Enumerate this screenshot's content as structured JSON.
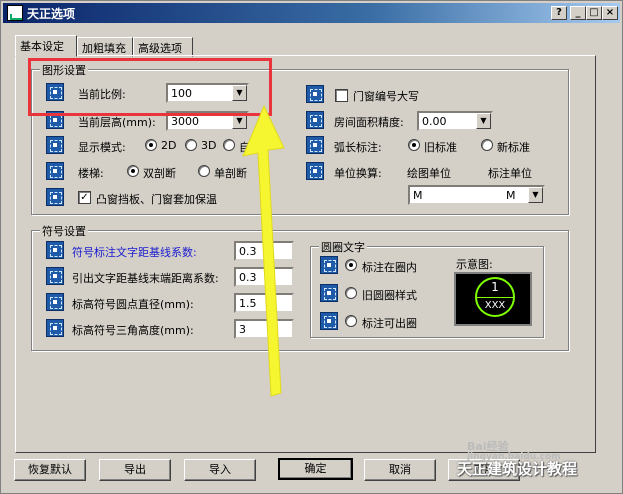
{
  "window": {
    "title": "天正选项",
    "controls": {
      "help": "?",
      "minimize": "_",
      "maximize": "□",
      "close": "×"
    }
  },
  "tabs": [
    {
      "label": "基本设定",
      "active": true
    },
    {
      "label": "加粗填充",
      "active": false
    },
    {
      "label": "高级选项",
      "active": false
    }
  ],
  "graphics": {
    "title": "图形设置",
    "scale_label": "当前比例:",
    "scale_value": "100",
    "floor_height_label": "当前层高(mm):",
    "floor_height_value": "3000",
    "display_mode_label": "显示模式:",
    "display_options": [
      "2D",
      "3D",
      "自动"
    ],
    "display_selected": "2D",
    "stairs_label": "楼梯:",
    "stairs_options": [
      "双剖断",
      "单剖断"
    ],
    "stairs_selected": "双剖断",
    "bay_window_label": "凸窗挡板、门窗套加保温",
    "bay_window_checked": true,
    "door_caps_label": "门窗编号大写",
    "door_caps_checked": false,
    "room_precision_label": "房间面积精度:",
    "room_precision_value": "0.00",
    "arc_label": "弧长标注:",
    "arc_options": [
      "旧标准",
      "新标准"
    ],
    "arc_selected": "旧标准",
    "unit_convert_label": "单位换算:",
    "drawing_unit_label": "绘图单位",
    "annotation_unit_label": "标注单位",
    "unit_combo_left": "M",
    "unit_combo_right": "M"
  },
  "symbols": {
    "title": "符号设置",
    "rows": [
      {
        "label": "符号标注文字距基线系数:",
        "value": "0.3"
      },
      {
        "label": "引出文字距基线末端距离系数:",
        "value": "0.3"
      },
      {
        "label": "标高符号圆点直径(mm):",
        "value": "1.5"
      },
      {
        "label": "标高符号三角高度(mm):",
        "value": "3"
      }
    ],
    "circle_text": {
      "title": "圆圈文字",
      "options": [
        "标注在圈内",
        "旧圆圈样式",
        "标注可出圈"
      ],
      "selected": "标注在圈内",
      "preview_label": "示意图:",
      "preview_number": "1",
      "preview_text": "XXX"
    }
  },
  "buttons": {
    "restore": "恢复默认",
    "export": "导出",
    "import": "导入",
    "ok": "确定",
    "cancel": "取消",
    "apply": "应用"
  },
  "overlays": {
    "watermark_wechat": "天正建筑设计教程",
    "watermark_baidu": "Bai经验",
    "watermark_url": "jingyan.baidu.com",
    "highlight_color": "#e8343a",
    "arrow_color": "#f5f530"
  }
}
